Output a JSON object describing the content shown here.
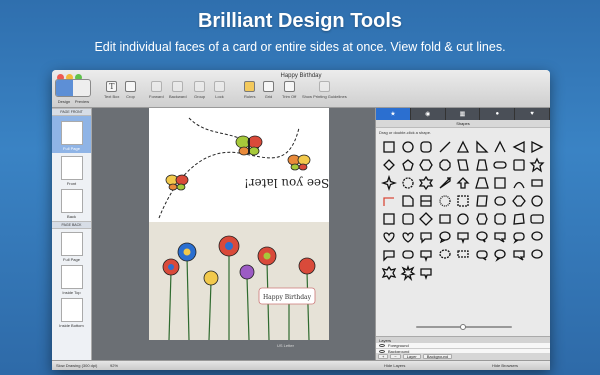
{
  "promo": {
    "title": "Brilliant Design Tools",
    "subtitle": "Edit individual faces of a card or entire sides at once. View fold & cut lines."
  },
  "window": {
    "title": "Happy Birthday",
    "toolbar": {
      "mode_design": "Design",
      "mode_preview": "Preview",
      "text_box": "Text Box",
      "crop": "Crop",
      "forward": "Forward",
      "backward": "Backward",
      "group": "Group",
      "lock": "Lock",
      "rulers": "Rulers",
      "grid": "Grid",
      "trim_off": "Trim Off",
      "show_print_guidelines": "Show Printing Guidelines"
    }
  },
  "sidebar": {
    "front_header": "PAGE FRONT",
    "back_header": "PAGE BACK",
    "items_front": [
      {
        "label": "Full Page",
        "selected": true
      },
      {
        "label": "Front",
        "selected": false
      },
      {
        "label": "Back",
        "selected": false
      }
    ],
    "items_back": [
      {
        "label": "Full Page",
        "selected": false
      },
      {
        "label": "Inside Top",
        "selected": false
      },
      {
        "label": "Inside Bottom",
        "selected": false
      }
    ]
  },
  "canvas": {
    "card_message": "See you later!",
    "banner_text": "Happy Birthday",
    "paper_size": "US Letter"
  },
  "statusbar": {
    "drawing_quality": "Slow Drawing (300 dpi)",
    "zoom": "92%",
    "hide_layers": "Hide Layers",
    "hide_browsers": "Hide Browsers"
  },
  "inspector": {
    "tabs": [
      "star",
      "camera",
      "grid",
      "person",
      "heart"
    ],
    "shapes_header": "Shapes",
    "shapes_hint": "Drag or double-click a shape.",
    "layers_header": "Layers",
    "layers": [
      "Foreground",
      "Background"
    ],
    "layer_menu": "Layer",
    "background_menu": "Background"
  },
  "colors": {
    "accent": "#2b6fd0",
    "promo_bg": "#3a83c4",
    "canvas_bg": "#6b6f74"
  }
}
